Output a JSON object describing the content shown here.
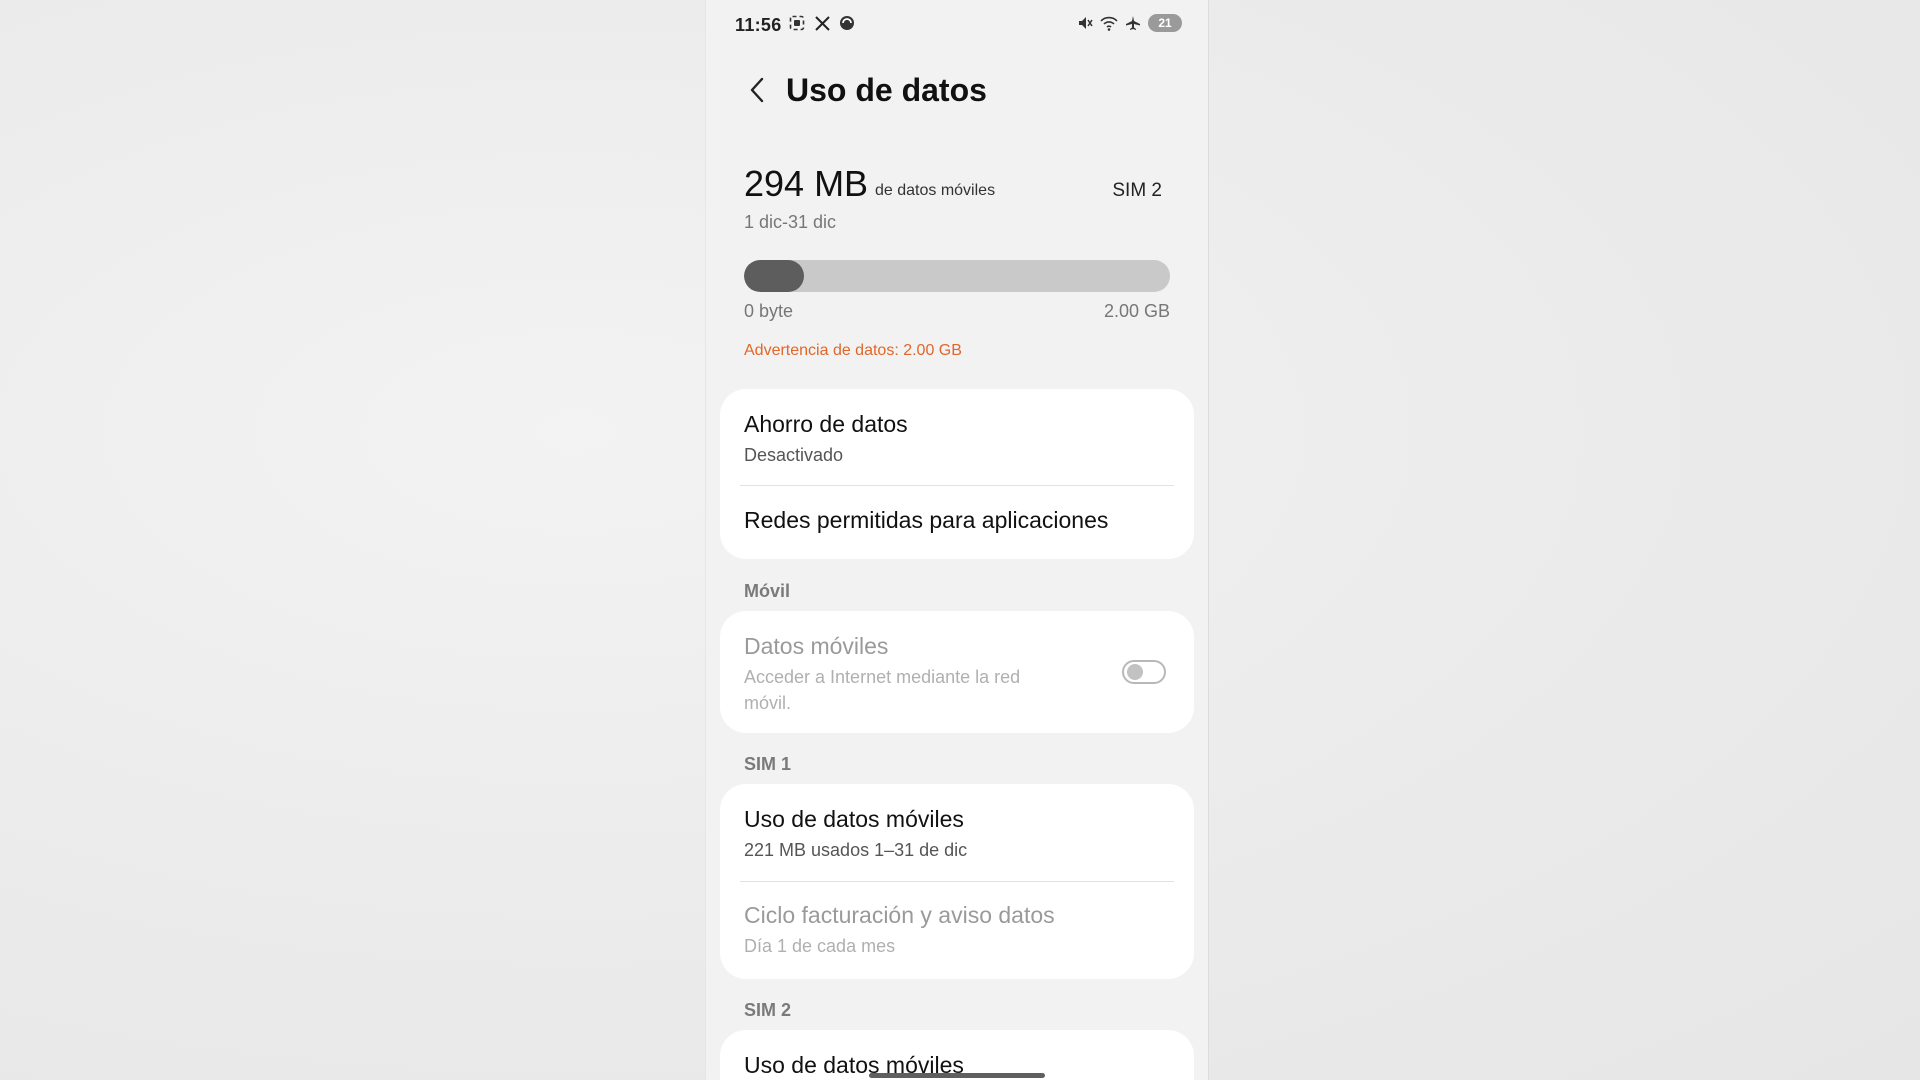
{
  "status_bar": {
    "time": "11:56",
    "left_icons": [
      "screenshot-icon",
      "x-logo-icon",
      "app-notification-icon"
    ],
    "right_icons": [
      "mute-icon",
      "wifi-icon",
      "airplane-icon"
    ],
    "battery": "21"
  },
  "header": {
    "title": "Uso de datos",
    "back_icon": "chevron-left-icon"
  },
  "usage": {
    "amount": "294 MB",
    "description": "de datos móviles",
    "sim": "SIM 2",
    "period": "1 dic-31 dic",
    "bar_min_label": "0 byte",
    "bar_max_label": "2.00 GB",
    "used_fraction": 0.14,
    "warning": "Advertencia de datos: 2.00 GB",
    "warning_color": "#e0672a"
  },
  "general_card": {
    "saver_title": "Ahorro de datos",
    "saver_status": "Desactivado",
    "allowed_networks": "Redes permitidas para aplicaciones"
  },
  "mobile_section": {
    "label": "Móvil",
    "mobile_data_title": "Datos móviles",
    "mobile_data_sub_1": "Acceder a Internet mediante la red",
    "mobile_data_sub_2": "móvil.",
    "mobile_data_enabled": false
  },
  "sim1_section": {
    "label": "SIM 1",
    "usage_title": "Uso de datos móviles",
    "usage_sub": "221 MB usados 1–31 de dic",
    "billing_title": "Ciclo facturación y aviso datos",
    "billing_sub": "Día 1 de cada mes"
  },
  "sim2_section": {
    "label": "SIM 2",
    "usage_title": "Uso de datos móviles"
  },
  "colors": {
    "background": "#f2f2f2",
    "card": "#ffffff",
    "bar_fill": "#5d5d5d",
    "bar_track": "#c9c9c9"
  }
}
